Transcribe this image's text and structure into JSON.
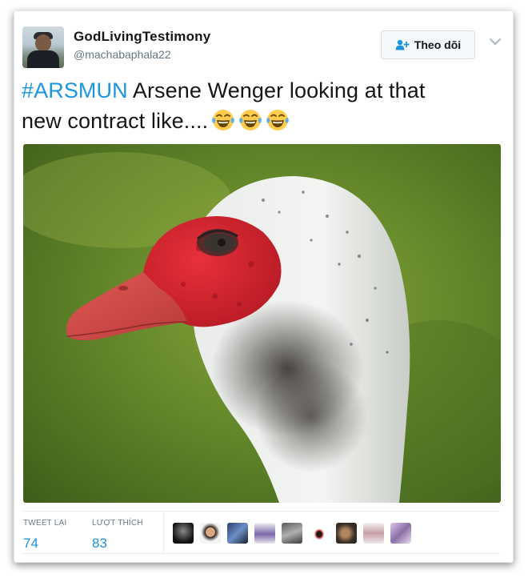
{
  "tweet": {
    "author_name": "GodLivingTestimony",
    "author_handle": "@machabaphala22",
    "follow_label": "Theo dõi",
    "hashtag": "#ARSMUN",
    "text_line1": " Arsene Wenger looking at that",
    "text_line2": "new contract like....",
    "emojis": [
      "face-with-tears-of-joy",
      "face-with-tears-of-joy",
      "face-with-tears-of-joy"
    ]
  },
  "stats": {
    "retweets_label": "TWEET LẠI",
    "retweets_value": "74",
    "likes_label": "LƯỢT THÍCH",
    "likes_value": "83"
  },
  "likers": [
    "avatar-1",
    "avatar-2",
    "avatar-3",
    "avatar-4",
    "avatar-5",
    "avatar-6",
    "avatar-7",
    "avatar-8",
    "avatar-9"
  ],
  "colors": {
    "link": "#1b95e0",
    "text": "#14171a",
    "muted": "#657786"
  }
}
